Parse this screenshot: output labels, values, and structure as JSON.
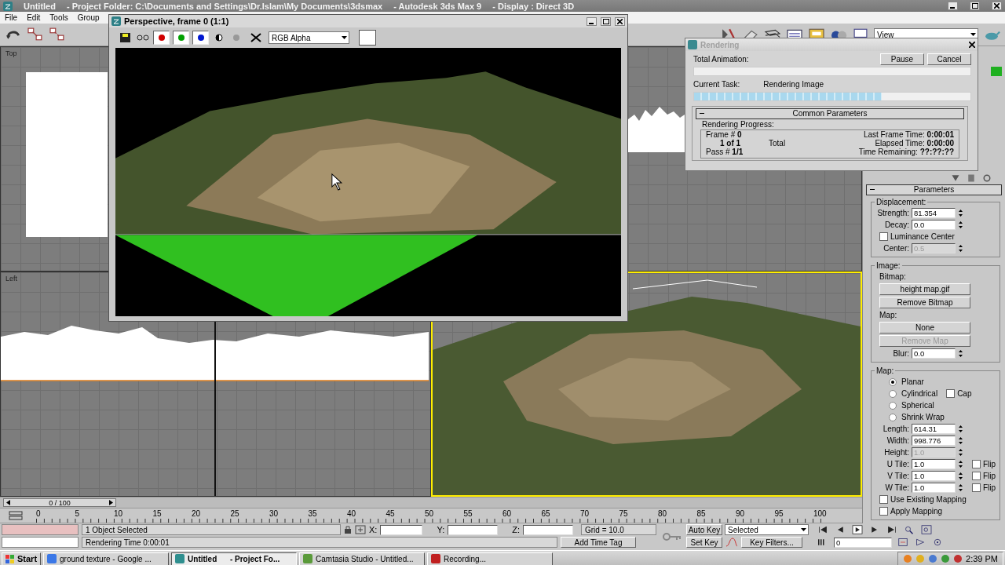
{
  "app_window": {
    "title": "Untitled",
    "project": "- Project Folder: C:\\Documents and Settings\\Dr.Islam\\My Documents\\3dsmax",
    "app": "- Autodesk 3ds Max 9",
    "display": "- Display : Direct 3D"
  },
  "menu": [
    "File",
    "Edit",
    "Tools",
    "Group"
  ],
  "toolbar": {
    "view_dropdown": "View"
  },
  "viewports": [
    {
      "kind": "top",
      "label": "Top",
      "active": false
    },
    {
      "kind": "front",
      "active": false
    },
    {
      "kind": "left",
      "label": "Left",
      "active": false
    },
    {
      "kind": "perspective",
      "active": true
    }
  ],
  "render_frame_window": {
    "title": "Perspective, frame 0 (1:1)",
    "channel": "RGB Alpha",
    "channels": [
      {
        "kind": "red",
        "on": true
      },
      {
        "kind": "green",
        "on": true
      },
      {
        "kind": "blue",
        "on": true
      }
    ]
  },
  "rendering_dialog": {
    "title": "Rendering",
    "buttons": [
      "Pause",
      "Cancel"
    ],
    "total_label": "Total Animation:",
    "total_progress": {
      "level": 0
    },
    "task_label": "Current Task:",
    "task": "Rendering Image",
    "task_progress": {
      "level": 0.68
    },
    "rollout": "Common Parameters",
    "group": "Rendering Progress:",
    "frame_label": "Frame #",
    "frame": "0",
    "count": "1 of 1",
    "total": "Total",
    "pass_label": "Pass #",
    "pass": "1/1",
    "stats": [
      {
        "label": "Last Frame Time:",
        "value": "0:00:01"
      },
      {
        "label": "Elapsed Time:",
        "value": "0:00:00"
      },
      {
        "label": "Time Remaining:",
        "value": "??:??:??"
      }
    ]
  },
  "command_panel": {
    "rollout": "Parameters",
    "groups": [
      {
        "title": "Displacement:",
        "rows": [
          {
            "kind": "spinner",
            "label": "Strength:",
            "value": "81.354",
            "disabled": false
          },
          {
            "kind": "spinner",
            "label": "Decay:",
            "value": "0.0",
            "disabled": false
          },
          {
            "kind": "checkbox",
            "label": "Luminance Center",
            "checked": false
          },
          {
            "kind": "spinner",
            "label": "Center:",
            "value": "0.5",
            "disabled": true
          }
        ]
      },
      {
        "title": "Image:",
        "rows": [
          {
            "kind": "sublabel",
            "label": "Bitmap:"
          },
          {
            "kind": "button",
            "label": "height map.gif",
            "disabled": false
          },
          {
            "kind": "button",
            "label": "Remove Bitmap",
            "disabled": false
          },
          {
            "kind": "sublabel",
            "label": "Map:"
          },
          {
            "kind": "button",
            "label": "None",
            "disabled": false
          },
          {
            "kind": "button",
            "label": "Remove Map",
            "disabled": true
          },
          {
            "kind": "spinner",
            "label": "Blur:",
            "value": "0.0",
            "disabled": false
          }
        ]
      },
      {
        "title": "Map:",
        "rows": [
          {
            "kind": "radio",
            "label": "Planar",
            "selected": true
          },
          {
            "kind": "radio",
            "label": "Cylindrical",
            "selected": false,
            "option": {
              "label": "Cap",
              "checked": false
            }
          },
          {
            "kind": "radio",
            "label": "Spherical",
            "selected": false
          },
          {
            "kind": "radio",
            "label": "Shrink Wrap",
            "selected": false
          },
          {
            "kind": "spinner",
            "label": "Length:",
            "value": "614.31",
            "disabled": false
          },
          {
            "kind": "spinner",
            "label": "Width:",
            "value": "998.776",
            "disabled": false
          },
          {
            "kind": "spinner",
            "label": "Height:",
            "value": "1.0",
            "disabled": true
          },
          {
            "kind": "spinner",
            "label": "U Tile:",
            "value": "1.0",
            "disabled": false,
            "option": {
              "label": "Flip",
              "checked": false
            }
          },
          {
            "kind": "spinner",
            "label": "V Tile:",
            "value": "1.0",
            "disabled": false,
            "option": {
              "label": "Flip",
              "checked": false
            }
          },
          {
            "kind": "spinner",
            "label": "W Tile:",
            "value": "1.0",
            "disabled": false,
            "option": {
              "label": "Flip",
              "checked": false
            }
          },
          {
            "kind": "checkbox",
            "label": "Use Existing Mapping",
            "checked": false
          },
          {
            "kind": "checkbox",
            "label": "Apply Mapping",
            "checked": false
          }
        ]
      }
    ]
  },
  "timeline": {
    "slider": "0 / 100",
    "level": 0,
    "ticks": [
      "0",
      "5",
      "10",
      "15",
      "20",
      "25",
      "30",
      "35",
      "40",
      "45",
      "50",
      "55",
      "60",
      "65",
      "70",
      "75",
      "80",
      "85",
      "90",
      "95",
      "100"
    ]
  },
  "status": {
    "selection": "1 Object Selected",
    "prompt": "Rendering Time  0:00:01",
    "x_label": "X:",
    "y_label": "Y:",
    "z_label": "Z:",
    "grid": "Grid = 10.0",
    "time_tag": "Add Time Tag",
    "auto_key": "Auto Key",
    "key_mode": "Selected",
    "set_key": "Set Key",
    "key_filters": "Key Filters...",
    "frame": "0"
  },
  "taskbar": {
    "start": "Start",
    "tasks": [
      {
        "label": "ground texture - Google ...",
        "kind": "browser",
        "selected": false
      },
      {
        "label": "Untitled      - Project Fo...",
        "kind": "max",
        "selected": true
      },
      {
        "label": "Camtasia Studio - Untitled...",
        "kind": "camtasia",
        "selected": false
      },
      {
        "label": "Recording...",
        "kind": "recorder",
        "selected": false
      }
    ],
    "clock": "2:39 PM"
  }
}
